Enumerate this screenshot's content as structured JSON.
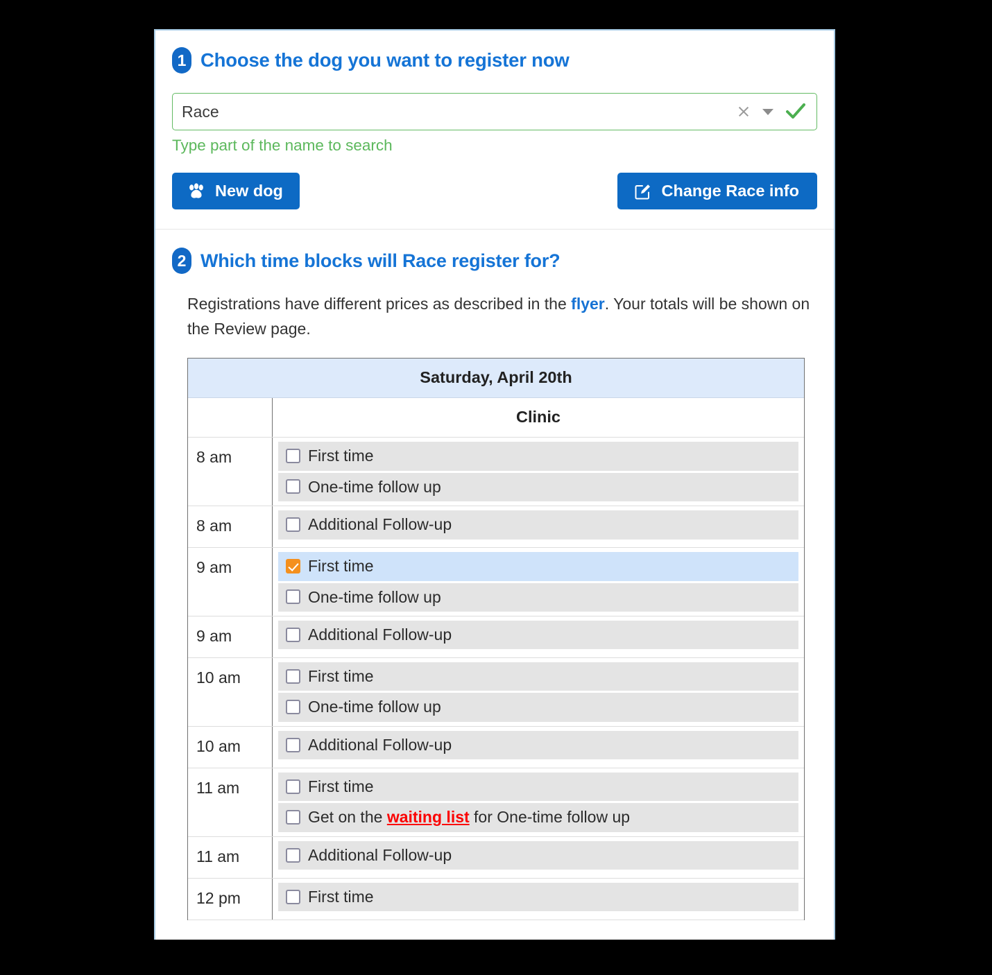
{
  "steps": {
    "one": {
      "number": "1",
      "title": "Choose the dog you want to register now"
    },
    "two": {
      "number": "2",
      "title": "Which time blocks will Race register for?"
    }
  },
  "search": {
    "value": "Race",
    "placeholder": "Type part of the name to search",
    "hint": "Type part of the name to search",
    "clear_icon": "close-icon",
    "dropdown_icon": "chevron-down-icon",
    "valid_icon": "check-icon"
  },
  "buttons": {
    "new_dog": {
      "label": "New dog",
      "icon": "paw-icon"
    },
    "change_info": {
      "label": "Change Race info",
      "icon": "edit-icon"
    }
  },
  "description": {
    "before_link": "Registrations have different prices as described in the ",
    "link": "flyer",
    "after_link": ". Your totals will be shown on the Review page."
  },
  "table": {
    "day_header": "Saturday, April 20th",
    "col_time_header": "",
    "col_clinic_header": "Clinic",
    "rows": [
      {
        "time": "8 am",
        "options": [
          {
            "label": "First time",
            "checked": false,
            "selected": false
          },
          {
            "label": "One-time follow up",
            "checked": false,
            "selected": false
          }
        ]
      },
      {
        "time": "8 am",
        "options": [
          {
            "label": "Additional Follow-up",
            "checked": false,
            "selected": false
          }
        ]
      },
      {
        "time": "9 am",
        "options": [
          {
            "label": "First time",
            "checked": true,
            "selected": true
          },
          {
            "label": "One-time follow up",
            "checked": false,
            "selected": false
          }
        ]
      },
      {
        "time": "9 am",
        "options": [
          {
            "label": "Additional Follow-up",
            "checked": false,
            "selected": false
          }
        ]
      },
      {
        "time": "10 am",
        "options": [
          {
            "label": "First time",
            "checked": false,
            "selected": false
          },
          {
            "label": "One-time follow up",
            "checked": false,
            "selected": false
          }
        ]
      },
      {
        "time": "10 am",
        "options": [
          {
            "label": "Additional Follow-up",
            "checked": false,
            "selected": false
          }
        ]
      },
      {
        "time": "11 am",
        "options": [
          {
            "label": "First time",
            "checked": false,
            "selected": false
          },
          {
            "label": "Get on the waiting list for One-time follow up",
            "checked": false,
            "selected": false,
            "link_text": "waiting list",
            "before_link": "Get on the ",
            "after_link": " for One-time follow up"
          }
        ]
      },
      {
        "time": "11 am",
        "options": [
          {
            "label": "Additional Follow-up",
            "checked": false,
            "selected": false
          }
        ]
      },
      {
        "time": "12 pm",
        "options": [
          {
            "label": "First time",
            "checked": false,
            "selected": false
          }
        ]
      }
    ]
  },
  "colors": {
    "brand_blue": "#0d6ac4",
    "heading_blue": "#1574d6",
    "hint_green": "#5cb85c",
    "checked_orange": "#f4901e",
    "selected_row": "#cfe3fa",
    "option_bg": "#e4e4e4",
    "day_header_bg": "#ddeafb",
    "waiting_link_red": "#fb0303"
  }
}
